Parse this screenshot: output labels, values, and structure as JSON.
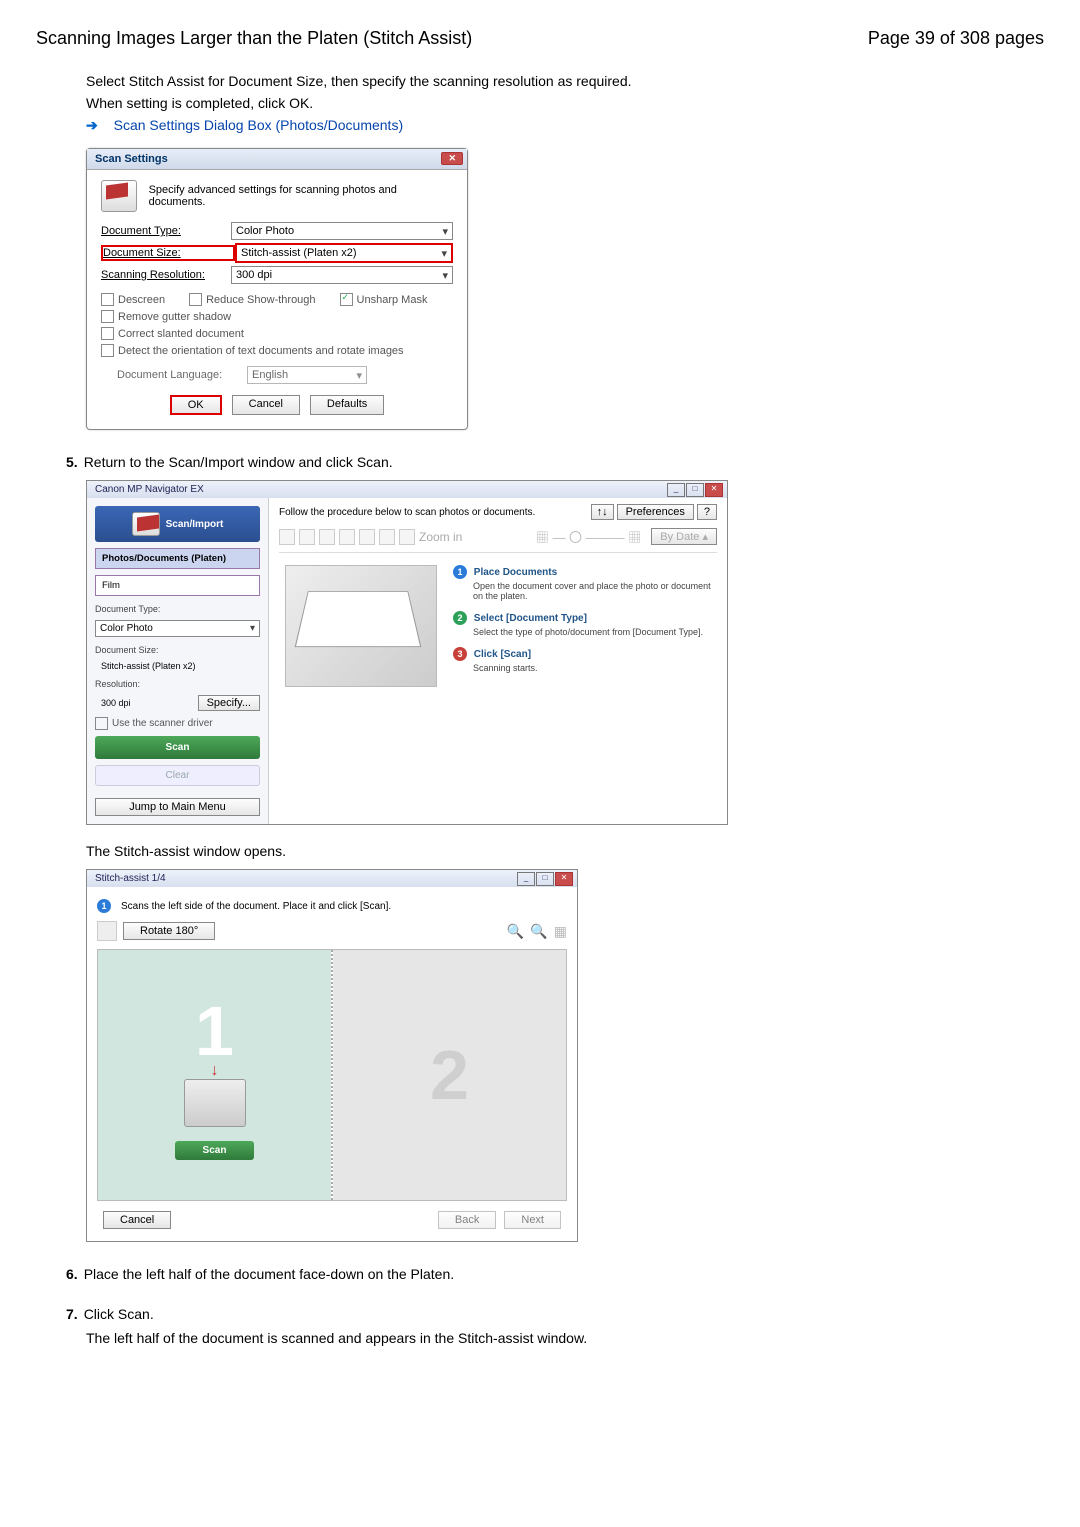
{
  "header": {
    "title": "Scanning Images Larger than the Platen (Stitch Assist)",
    "page": "Page 39 of 308 pages"
  },
  "intro_p1": "Select Stitch Assist for Document Size, then specify the scanning resolution as required.",
  "intro_p2": "When setting is completed, click OK.",
  "link1": "Scan Settings Dialog Box (Photos/Documents)",
  "scanSettings": {
    "title": "Scan Settings",
    "desc": "Specify advanced settings for scanning photos and documents.",
    "rows": {
      "type_label": "Document Type:",
      "type_val": "Color Photo",
      "size_label": "Document Size:",
      "size_val": "Stitch-assist (Platen x2)",
      "res_label": "Scanning Resolution:",
      "res_val": "300 dpi"
    },
    "checks": {
      "descreen": "Descreen",
      "reduce": "Reduce Show-through",
      "unsharp": "Unsharp Mask",
      "gutter": "Remove gutter shadow",
      "slant": "Correct slanted document",
      "detect": "Detect the orientation of text documents and rotate images",
      "lang_label": "Document Language:",
      "lang_val": "English"
    },
    "buttons": {
      "ok": "OK",
      "cancel": "Cancel",
      "defaults": "Defaults"
    }
  },
  "step5": {
    "num": "5.",
    "text": "Return to the Scan/Import window and click Scan."
  },
  "navigator": {
    "title": "Canon MP Navigator EX",
    "scan_import": "Scan/Import",
    "tabs": {
      "photos": "Photos/Documents (Platen)",
      "film": "Film"
    },
    "doc_type_label": "Document Type:",
    "doc_type_val": "Color Photo",
    "doc_size_label": "Document Size:",
    "doc_size_val": "Stitch-assist (Platen x2)",
    "res_label": "Resolution:",
    "res_val": "300 dpi",
    "specify_btn": "Specify...",
    "use_driver": "Use the scanner driver",
    "scan_btn": "Scan",
    "clear_btn": "Clear",
    "jump_btn": "Jump to Main Menu",
    "top_instr": "Follow the procedure below to scan photos or documents.",
    "sort_btn": "↑↓",
    "pref_btn": "Preferences",
    "help_btn": "?",
    "zoom_label": "Zoom in",
    "bydate": "By Date ▴",
    "steps": {
      "s1_title": "Place Documents",
      "s1_desc": "Open the document cover and place the photo or document on the platen.",
      "s2_title": "Select [Document Type]",
      "s2_desc": "Select the type of photo/document from [Document Type].",
      "s3_title": "Click [Scan]",
      "s3_desc": "Scanning starts."
    }
  },
  "stitch_open": "The Stitch-assist window opens.",
  "stitch": {
    "title": "Stitch-assist 1/4",
    "instr": "Scans the left side of the document. Place it and click [Scan].",
    "rotate_btn": "Rotate 180°",
    "num1": "1",
    "num2": "2",
    "scan_btn": "Scan",
    "cancel": "Cancel",
    "back": "Back",
    "next": "Next"
  },
  "step6": {
    "num": "6.",
    "text": "Place the left half of the document face-down on the Platen."
  },
  "step7": {
    "num": "7.",
    "text": "Click Scan."
  },
  "step7_desc": "The left half of the document is scanned and appears in the Stitch-assist window."
}
